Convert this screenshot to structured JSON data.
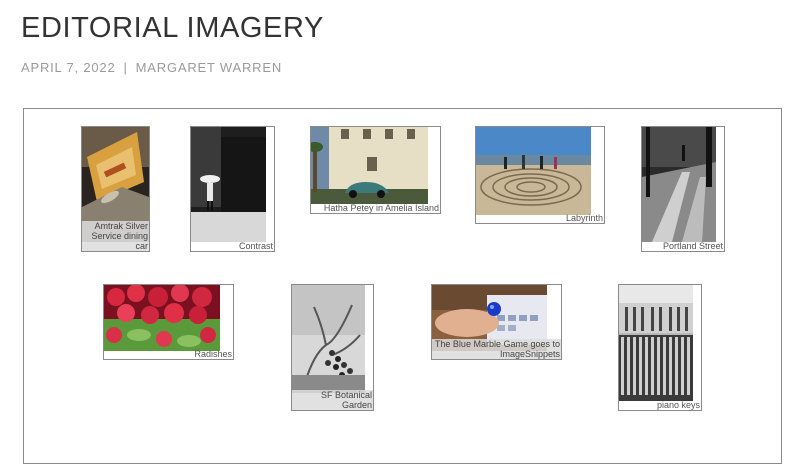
{
  "post": {
    "title": "EDITORIAL IMAGERY",
    "date": "APRIL 7, 2022",
    "separator": "|",
    "author": "MARGARET WARREN"
  },
  "gallery": {
    "items": [
      {
        "caption": "Amtrak Silver Service dining car",
        "icon": "train-photo"
      },
      {
        "caption": "Contrast",
        "icon": "umbrella-street-photo"
      },
      {
        "caption": "Hatha Petey in Amelia Island",
        "icon": "car-building-photo"
      },
      {
        "caption": "Labyrinth",
        "icon": "beach-labyrinth-photo"
      },
      {
        "caption": "Portland Street",
        "icon": "street-photo"
      },
      {
        "caption": "Radishes",
        "icon": "radishes-photo"
      },
      {
        "caption": "SF Botanical Garden",
        "icon": "botanical-photo"
      },
      {
        "caption": "The Blue Marble Game goes to ImageSnippets",
        "icon": "game-photo"
      },
      {
        "caption": "piano keys",
        "icon": "piano-photo"
      }
    ]
  }
}
